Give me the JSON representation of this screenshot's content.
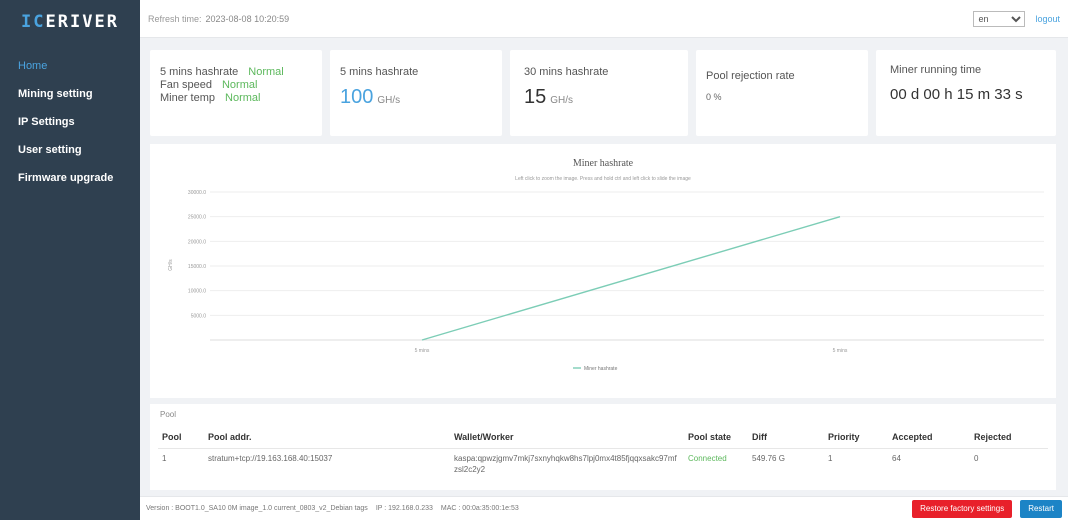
{
  "sidebar": {
    "logo_a": "IC",
    "logo_b": "ERIVER",
    "items": [
      {
        "label": "Home"
      },
      {
        "label": "Mining setting"
      },
      {
        "label": "IP Settings"
      },
      {
        "label": "User setting"
      },
      {
        "label": "Firmware upgrade"
      }
    ]
  },
  "topbar": {
    "time_label": "Refresh time:",
    "time_value": "2023-08-08 10:20:59",
    "language": "en",
    "logout": "logout"
  },
  "status_card": {
    "row1_label": "5 mins hashrate",
    "row1_value": "Normal",
    "row2_label": "Fan speed",
    "row2_value": "Normal",
    "row3_label": "Miner temp",
    "row3_value": "Normal"
  },
  "hash5": {
    "title": "5 mins hashrate",
    "value": "100",
    "unit": "GH/s"
  },
  "hash30": {
    "title": "30 mins hashrate",
    "value": "15",
    "unit": "GH/s"
  },
  "rejection": {
    "title": "Pool rejection rate",
    "value": "0 %"
  },
  "runtime": {
    "title": "Miner running time",
    "value": "00 d 00 h 15 m 33 s"
  },
  "chart_data": {
    "type": "line",
    "title": "Miner hashrate",
    "subtitle": "Left click to zoom the image. Press and hold ctrl and left click to slide the image",
    "ylabel": "GH/s",
    "yticks": [
      "5000.0",
      "10000.0",
      "15000.0",
      "20000.0",
      "25000.0",
      "30000.0"
    ],
    "ylim": [
      0,
      30000
    ],
    "xticks": [
      "5 mins",
      "5 mins"
    ],
    "series": [
      {
        "name": "Miner hashrate",
        "points": [
          [
            0,
            0
          ],
          [
            1,
            25000
          ]
        ]
      }
    ],
    "color": "#7ccdb6",
    "legend": "bottom"
  },
  "pool": {
    "title": "Pool",
    "headers": [
      "Pool",
      "Pool addr.",
      "Wallet/Worker",
      "Pool state",
      "Diff",
      "Priority",
      "Accepted",
      "Rejected"
    ],
    "rows": [
      [
        "1",
        "stratum+tcp://19.163.168.40:15037",
        "kaspa:qpwzjgmv7mkj7sxnyhqkw8hs7lpj0mx4t85fjqqxsakc97mfzsl2c2y2",
        "Connected",
        "549.76 G",
        "1",
        "64",
        "0"
      ]
    ]
  },
  "footer": {
    "version": "Version : BOOT1.0_SA10 0M image_1.0 current_0803_v2_Debian tags",
    "ip": "IP : 192.168.0.233",
    "mac": "MAC : 00:0a:35:00:1e:53",
    "restore": "Restore factory settings",
    "restart": "Restart"
  }
}
